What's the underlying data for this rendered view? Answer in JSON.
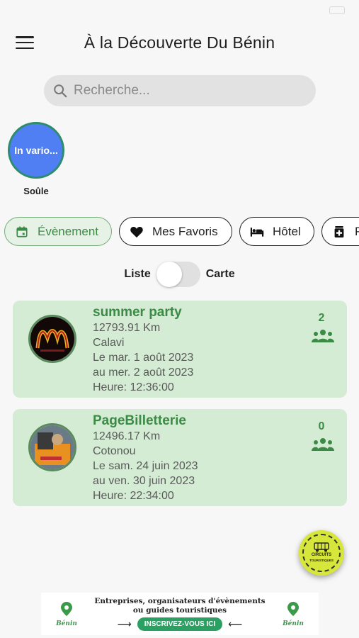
{
  "header": {
    "title": "À la Découverte Du Bénin"
  },
  "search": {
    "placeholder": "Recherche..."
  },
  "categories": [
    {
      "bubble_text": "In vario...",
      "label": "Soûle",
      "color": "#4f7ff2"
    }
  ],
  "filters": [
    {
      "label": "Évènement",
      "icon": "calendar-icon",
      "active": true
    },
    {
      "label": "Mes Favoris",
      "icon": "heart-icon",
      "active": false
    },
    {
      "label": "Hôtel",
      "icon": "bed-icon",
      "active": false
    },
    {
      "label": "P",
      "icon": "pharmacy-icon",
      "active": false
    }
  ],
  "view_toggle": {
    "left_label": "Liste",
    "right_label": "Carte",
    "state": "Liste"
  },
  "events": [
    {
      "title": "summer party",
      "distance": "12793.91 Km",
      "city": "Calavi",
      "start": "Le mar. 1 août 2023",
      "end": "au mer. 2 août 2023",
      "time": "Heure: 12:36:00",
      "participants": "2"
    },
    {
      "title": "PageBilletterie",
      "distance": "12496.17 Km",
      "city": "Cotonou",
      "start": "Le sam. 24 juin 2023",
      "end": "au ven. 30 juin 2023",
      "time": "Heure: 22:34:00",
      "participants": "0"
    }
  ],
  "fab": {
    "label_line1": "CIRCUITS",
    "label_line2": "TOURISTIQUES"
  },
  "banner": {
    "line1": "Entreprises, organisateurs d'évènements",
    "line2": "ou guides touristiques",
    "cta": "INSCRIVEZ-VOUS ICI",
    "logo_text": "Bénin"
  },
  "colors": {
    "accent": "#3b8a45",
    "card_bg": "#d4ebd4",
    "category_bubble": "#4f7ff2",
    "fab": "#d7e63a",
    "cta": "#2aa063"
  }
}
